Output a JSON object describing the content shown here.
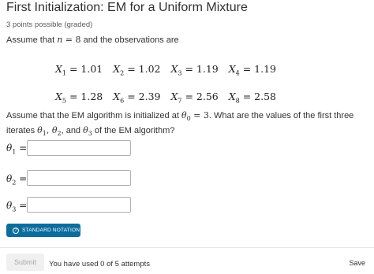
{
  "header": {
    "title": "First Initialization: EM for a Uniform Mixture",
    "points": "3 points possible (graded)"
  },
  "intro": {
    "prefix": "Assume that ",
    "n_var": "n",
    "equals": " = ",
    "n_value": "8",
    "suffix": " and the observations are"
  },
  "observations": {
    "row1": [
      {
        "sym": "X",
        "idx": "1",
        "value": "1.01"
      },
      {
        "sym": "X",
        "idx": "2",
        "value": "1.02"
      },
      {
        "sym": "X",
        "idx": "3",
        "value": "1.19"
      },
      {
        "sym": "X",
        "idx": "4",
        "value": "1.19"
      }
    ],
    "row2": [
      {
        "sym": "X",
        "idx": "5",
        "value": "1.28"
      },
      {
        "sym": "X",
        "idx": "6",
        "value": "2.39"
      },
      {
        "sym": "X",
        "idx": "7",
        "value": "2.56"
      },
      {
        "sym": "X",
        "idx": "8",
        "value": "2.58"
      }
    ]
  },
  "question": {
    "part1": "Assume that the EM algorithm is initialized at ",
    "theta0_idx": "0",
    "theta0_value": "3",
    "part2": ". What are the values of the first three iterates ",
    "part3": " and ",
    "part4": " of the EM algorithm?"
  },
  "fields": [
    {
      "label_sym": "θ",
      "label_idx": "1",
      "equals": "=",
      "value": ""
    },
    {
      "label_sym": "θ",
      "label_idx": "2",
      "equals": "=",
      "value": ""
    },
    {
      "label_sym": "θ",
      "label_idx": "3",
      "equals": "=",
      "value": ""
    }
  ],
  "notation_button": {
    "label": "STANDARD NOTATION",
    "icon": "question-circle-icon"
  },
  "footer": {
    "submit_label": "Submit",
    "attempts_text": "You have used 0 of 5 attempts",
    "save_label": "Save"
  },
  "colors": {
    "accent": "#0c6d9d",
    "text": "#313131",
    "disabled": "#f0f0f0"
  }
}
